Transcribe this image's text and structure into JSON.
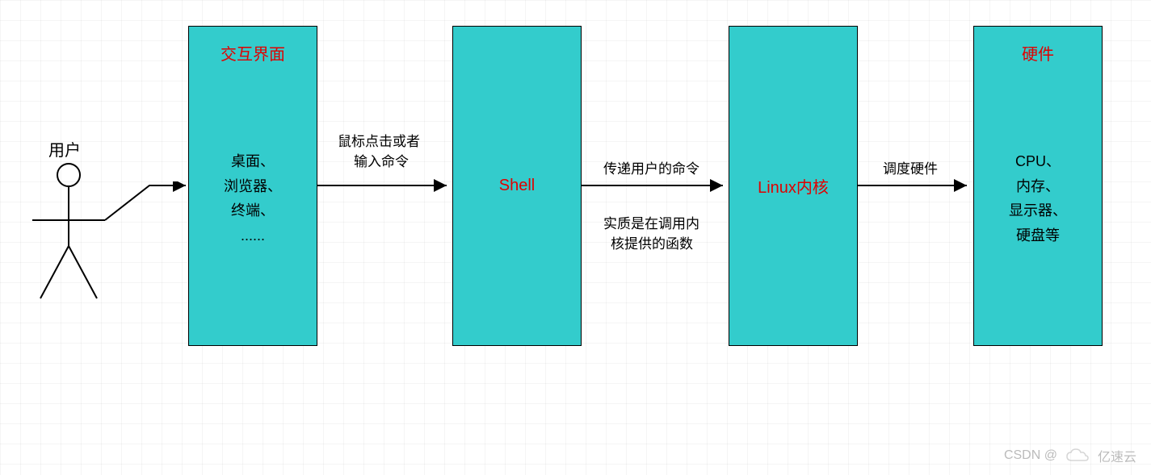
{
  "user_label": "用户",
  "boxes": {
    "ui": {
      "title": "交互界面",
      "body": [
        "桌面、",
        "浏览器、",
        "终端、",
        "......"
      ]
    },
    "shell": {
      "title": "Shell"
    },
    "kernel": {
      "title": "Linux内核"
    },
    "hardware": {
      "title": "硬件",
      "body": [
        "CPU、",
        "内存、",
        "显示器、",
        "硬盘等"
      ]
    }
  },
  "arrows": {
    "user_to_ui": {
      "top": "鼠标点击或者",
      "bottom": "输入命令"
    },
    "ui_to_shell": null,
    "shell_to_kernel": {
      "top": "传递用户的命令",
      "bottom_a": "实质是在调用内",
      "bottom_b": "核提供的函数"
    },
    "kernel_to_hw": {
      "top": "调度硬件"
    }
  },
  "watermark": {
    "left": "CSDN @",
    "right": "亿速云"
  },
  "colors": {
    "box_fill": "#33cccc",
    "title": "#e00000"
  }
}
